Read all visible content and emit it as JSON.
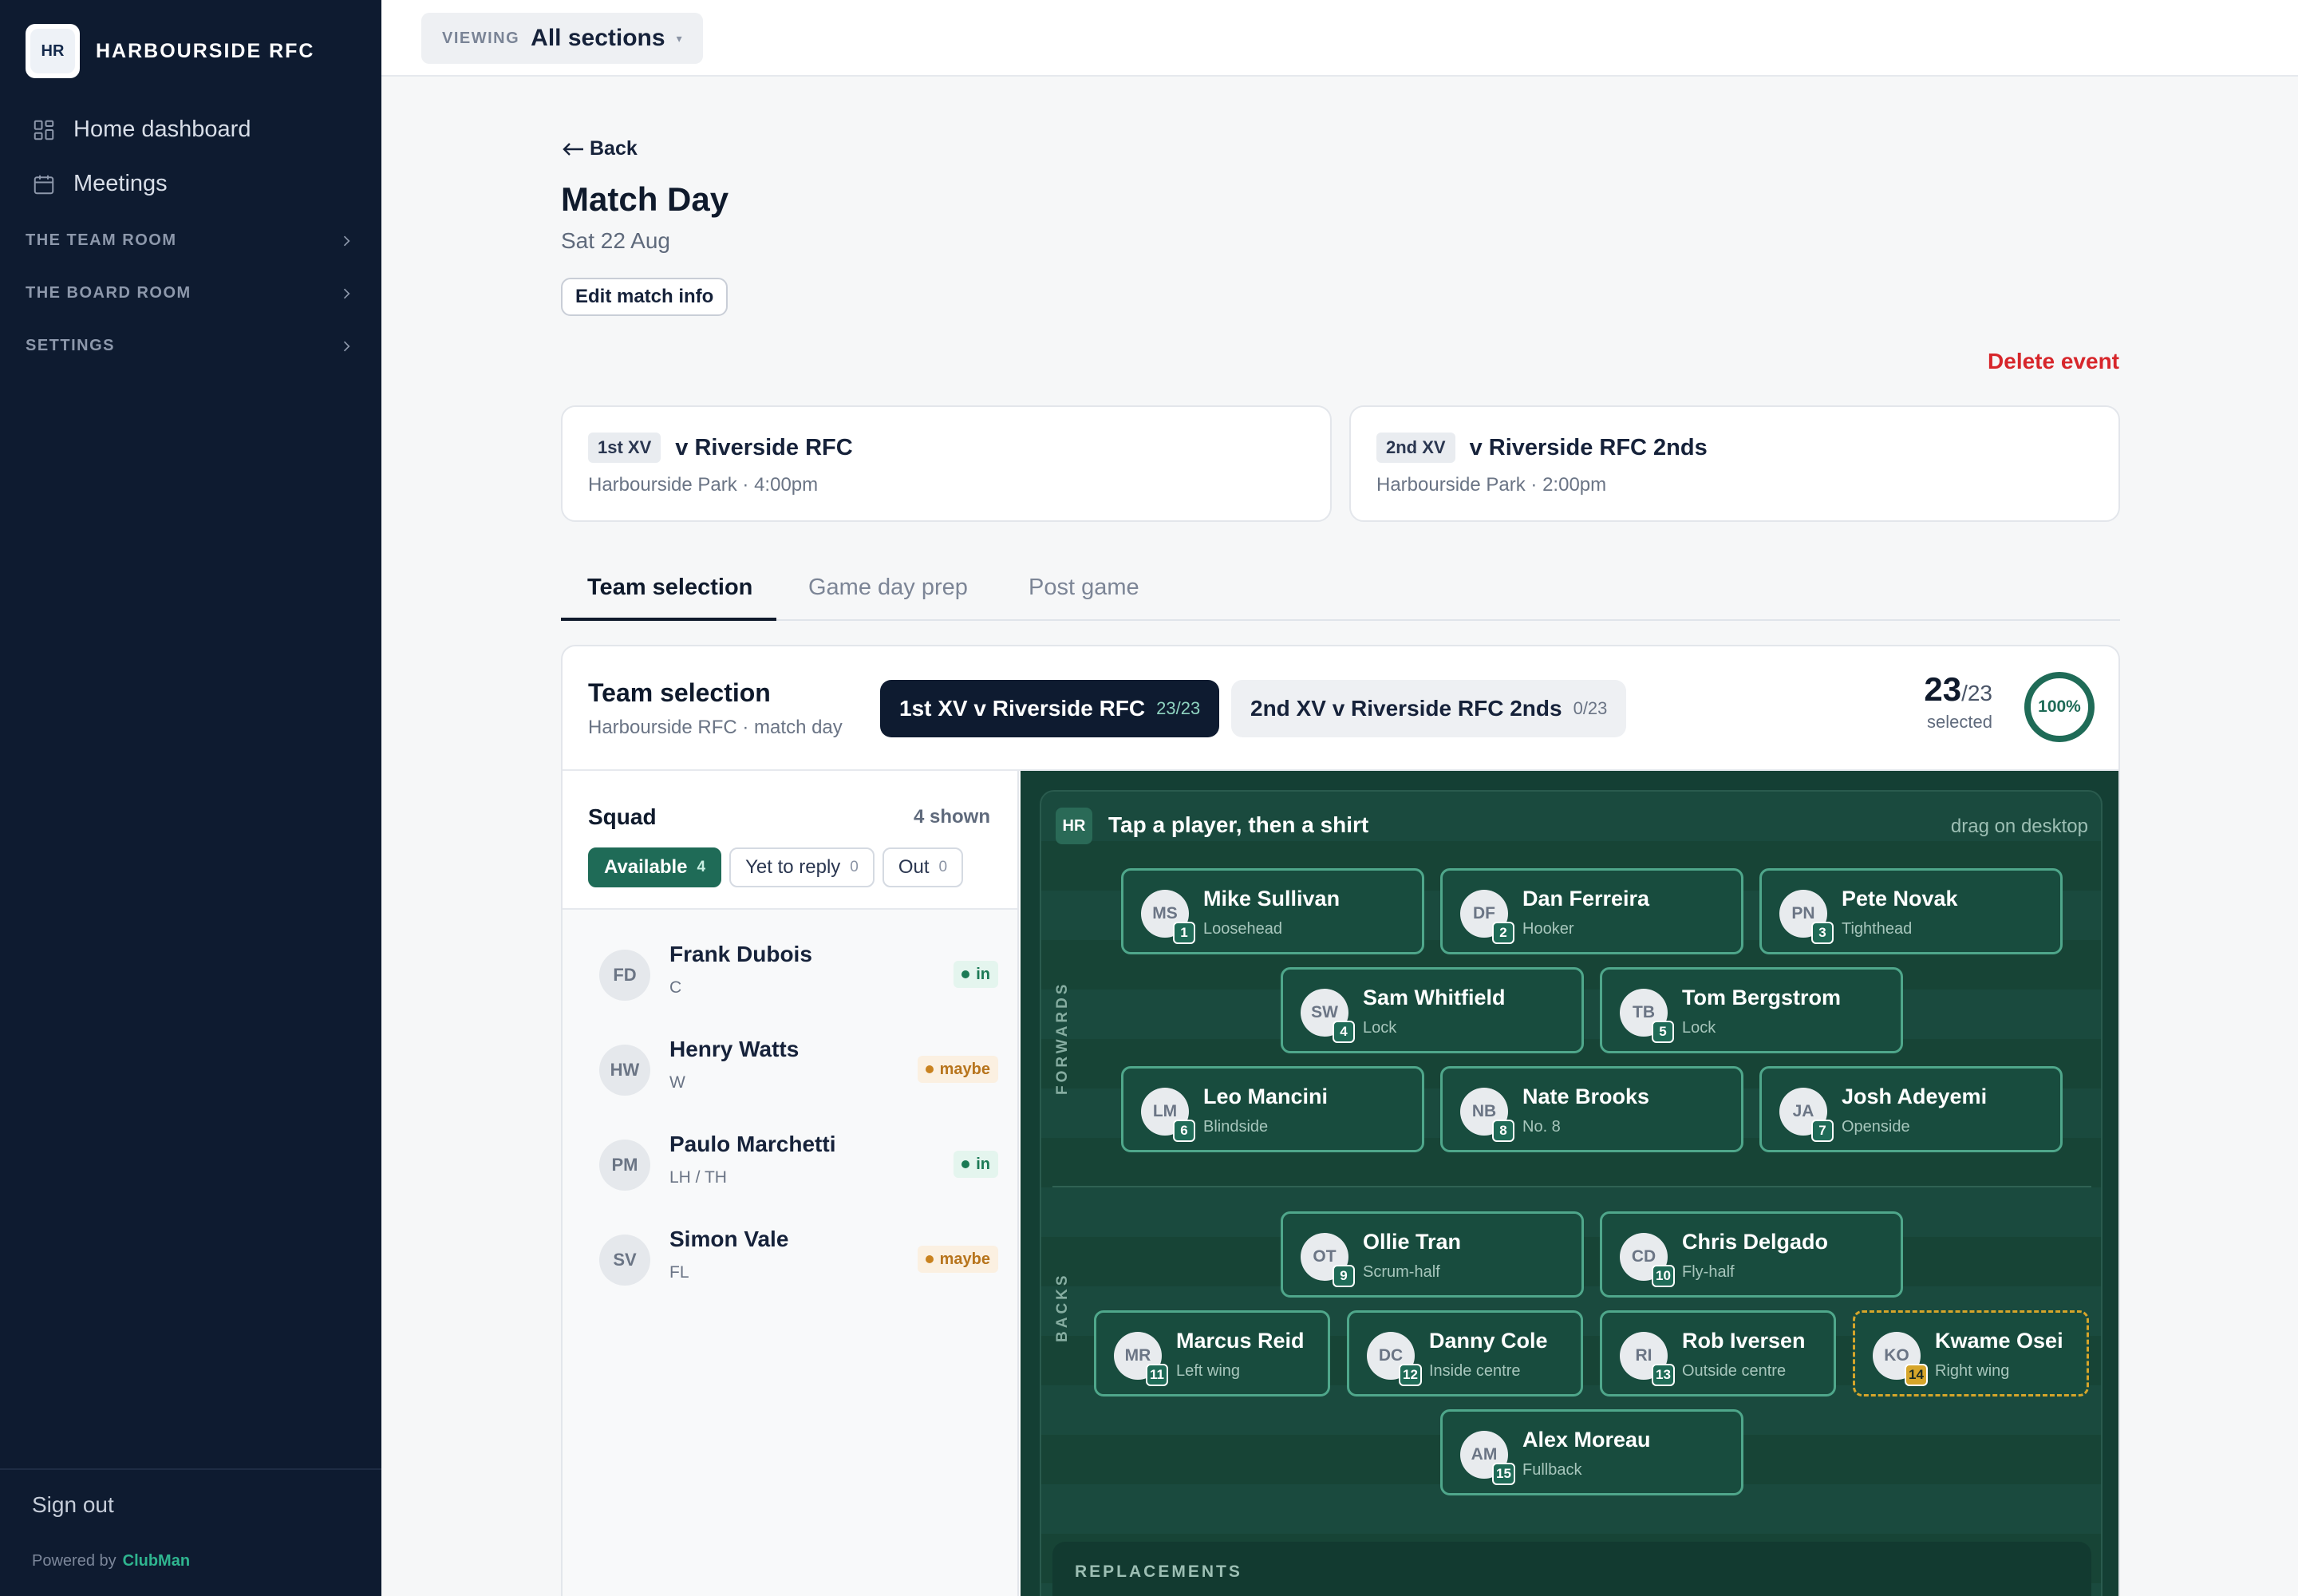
{
  "brand": {
    "initials": "HR",
    "name": "HARBOURSIDE RFC"
  },
  "sidebar": {
    "items": [
      {
        "label": "Home dashboard",
        "icon": "grid-icon"
      },
      {
        "label": "Meetings",
        "icon": "calendar-icon"
      }
    ],
    "groups": [
      "THE TEAM ROOM",
      "THE BOARD ROOM",
      "SETTINGS"
    ],
    "sign_out": "Sign out",
    "powered_label": "Powered by",
    "powered_brand": "ClubMan"
  },
  "topbar": {
    "viewing_label": "VIEWING",
    "viewing_value": "All sections",
    "caret": "▾"
  },
  "header": {
    "back": "Back",
    "title": "Match Day",
    "date": "Sat 22 Aug",
    "edit": "Edit match info",
    "delete": "Delete event"
  },
  "fixtures": [
    {
      "tag": "1st XV",
      "opponent": "v Riverside RFC",
      "venue": "Harbourside Park · 4:00pm"
    },
    {
      "tag": "2nd XV",
      "opponent": "v Riverside RFC 2nds",
      "venue": "Harbourside Park · 2:00pm"
    }
  ],
  "tabs": [
    "Team selection",
    "Game day prep",
    "Post game"
  ],
  "selection": {
    "title": "Team selection",
    "subtitle": "Harbourside RFC · match day",
    "teams": [
      {
        "label": "1st XV v Riverside RFC",
        "count": "23/23"
      },
      {
        "label": "2nd XV v Riverside RFC 2nds",
        "count": "0/23"
      }
    ],
    "selected_num": "23",
    "selected_den": "/23",
    "selected_label": "selected",
    "percent": "100%"
  },
  "squad": {
    "title": "Squad",
    "shown": "4 shown",
    "filters": [
      {
        "label": "Available",
        "count": "4"
      },
      {
        "label": "Yet to reply",
        "count": "0"
      },
      {
        "label": "Out",
        "count": "0"
      }
    ],
    "players": [
      {
        "initials": "FD",
        "name": "Frank Dubois",
        "pos": "C",
        "status": "in"
      },
      {
        "initials": "HW",
        "name": "Henry Watts",
        "pos": "W",
        "status": "maybe"
      },
      {
        "initials": "PM",
        "name": "Paulo Marchetti",
        "pos": "LH / TH",
        "status": "in"
      },
      {
        "initials": "SV",
        "name": "Simon Vale",
        "pos": "FL",
        "status": "maybe"
      }
    ]
  },
  "pitch": {
    "badge": "HR",
    "hint": "Tap a player, then a shirt",
    "drag": "drag on desktop",
    "forwards_label": "FORWARDS",
    "backs_label": "BACKS",
    "replacements_label": "REPLACEMENTS",
    "shirts": [
      {
        "initials": "MS",
        "num": "1",
        "name": "Mike Sullivan",
        "pos": "Loosehead"
      },
      {
        "initials": "DF",
        "num": "2",
        "name": "Dan Ferreira",
        "pos": "Hooker"
      },
      {
        "initials": "PN",
        "num": "3",
        "name": "Pete Novak",
        "pos": "Tighthead"
      },
      {
        "initials": "SW",
        "num": "4",
        "name": "Sam Whitfield",
        "pos": "Lock"
      },
      {
        "initials": "TB",
        "num": "5",
        "name": "Tom Bergstrom",
        "pos": "Lock"
      },
      {
        "initials": "LM",
        "num": "6",
        "name": "Leo Mancini",
        "pos": "Blindside"
      },
      {
        "initials": "NB",
        "num": "8",
        "name": "Nate Brooks",
        "pos": "No. 8"
      },
      {
        "initials": "JA",
        "num": "7",
        "name": "Josh Adeyemi",
        "pos": "Openside"
      },
      {
        "initials": "OT",
        "num": "9",
        "name": "Ollie Tran",
        "pos": "Scrum-half"
      },
      {
        "initials": "CD",
        "num": "10",
        "name": "Chris Delgado",
        "pos": "Fly-half"
      },
      {
        "initials": "MR",
        "num": "11",
        "name": "Marcus Reid",
        "pos": "Left wing"
      },
      {
        "initials": "DC",
        "num": "12",
        "name": "Danny Cole",
        "pos": "Inside centre"
      },
      {
        "initials": "RI",
        "num": "13",
        "name": "Rob Iversen",
        "pos": "Outside centre"
      },
      {
        "initials": "KO",
        "num": "14",
        "name": "Kwame Osei",
        "pos": "Right wing"
      },
      {
        "initials": "AM",
        "num": "15",
        "name": "Alex Moreau",
        "pos": "Fullback"
      }
    ]
  }
}
